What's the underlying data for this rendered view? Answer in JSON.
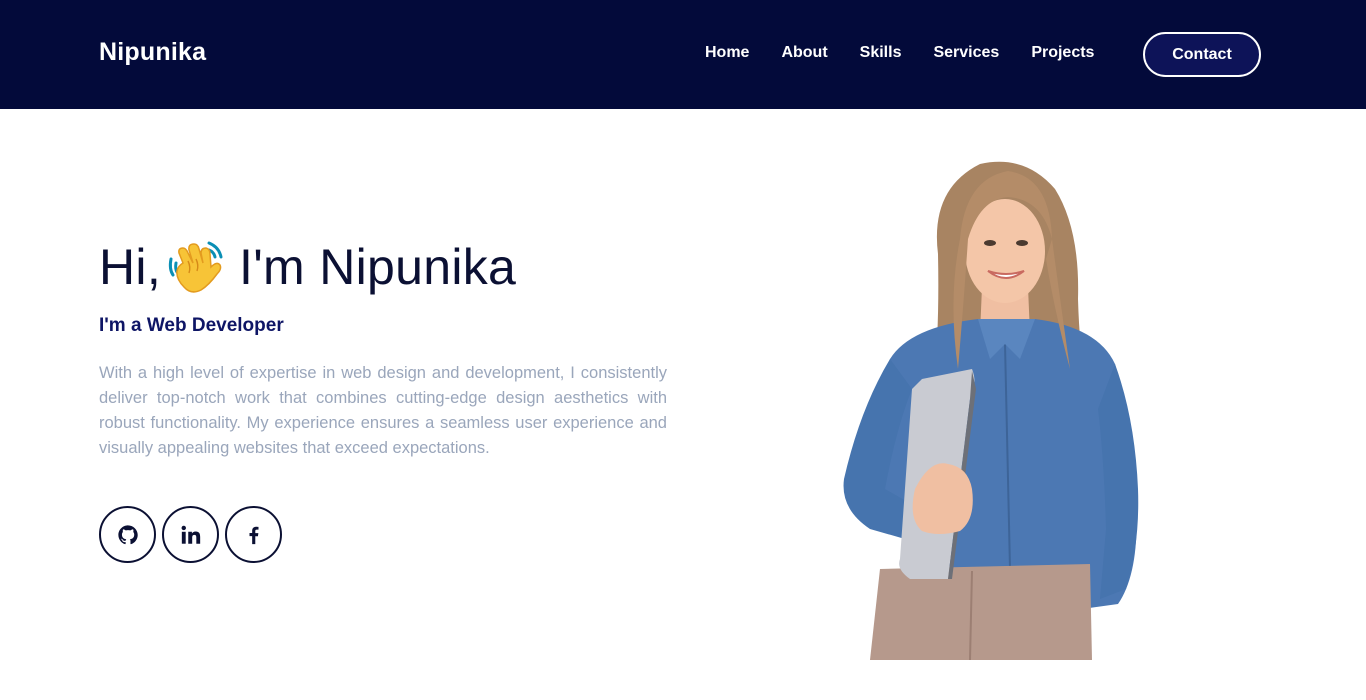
{
  "brand": {
    "name": "Nipunika"
  },
  "nav": {
    "items": [
      {
        "label": "Home"
      },
      {
        "label": "About"
      },
      {
        "label": "Skills"
      },
      {
        "label": "Services"
      },
      {
        "label": "Projects"
      }
    ],
    "contact_label": "Contact"
  },
  "hero": {
    "greeting_prefix": "Hi,",
    "greeting_suffix": "I'm Nipunika",
    "wave_icon": "waving-hand-icon",
    "subtitle": "I'm a Web Developer",
    "bio": "With a high level of expertise in web design and development, I consistently deliver top-notch work that combines cutting-edge design aesthetics with robust functionality. My experience ensures a seamless user experience and visually appealing websites that exceed expectations.",
    "socials": [
      {
        "icon": "github-icon"
      },
      {
        "icon": "linkedin-icon"
      },
      {
        "icon": "facebook-icon"
      }
    ]
  },
  "colors": {
    "navbar_bg": "#030a3a",
    "heading": "#0b1033",
    "subtitle": "#0e1565",
    "body_text": "#9aa6bb",
    "shirt": "#4c78b3",
    "pants": "#b6998c"
  }
}
